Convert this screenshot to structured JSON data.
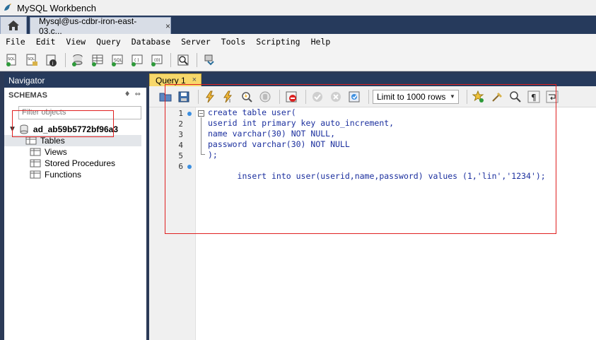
{
  "window": {
    "title": "MySQL Workbench"
  },
  "tabs": {
    "connection_label": "Mysql@us-cdbr-iron-east-03.c...",
    "close": "×"
  },
  "menu": {
    "items": [
      "File",
      "Edit",
      "View",
      "Query",
      "Database",
      "Server",
      "Tools",
      "Scripting",
      "Help"
    ]
  },
  "navigator": {
    "header": "Navigator",
    "schemas_label": "SCHEMAS",
    "filter_placeholder": "Filter objects",
    "schema_name": "ad_ab59b5772bf96a3",
    "items": [
      "Tables",
      "Views",
      "Stored Procedures",
      "Functions"
    ]
  },
  "query": {
    "tab_label": "Query 1",
    "tab_close": "×",
    "limit_label": "Limit to 1000 rows",
    "line_numbers": [
      "1",
      "2",
      "3",
      "4",
      "5",
      "6"
    ],
    "lines": [
      "create table user(",
      "userid int primary key auto_increment,",
      "name varchar(30) NOT NULL,",
      "password varchar(30) NOT NULL",
      ");",
      "insert into user(userid,name,password) values (1,'lin','1234');"
    ]
  },
  "colors": {
    "accent_dark": "#263a5c",
    "query_tab": "#f7d86b",
    "annotation": "#e02020"
  }
}
